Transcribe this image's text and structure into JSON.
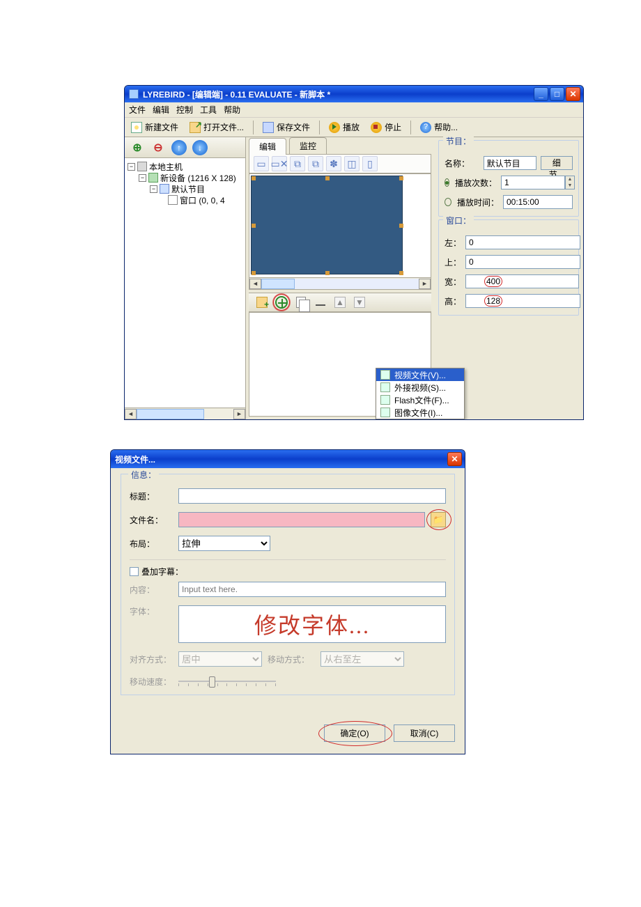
{
  "main": {
    "title": "LYREBIRD - [编辑端] - 0.11 EVALUATE - 新脚本 *",
    "menu": {
      "file": "文件",
      "edit": "编辑",
      "control": "控制",
      "tool": "工具",
      "help": "帮助"
    },
    "toolbar": {
      "new": "新建文件",
      "open": "打开文件...",
      "save": "保存文件",
      "play": "播放",
      "stop": "停止",
      "help": "帮助..."
    },
    "tree": {
      "root": "本地主机",
      "device": "新设备 (1216 X 128)",
      "program": "默认节目",
      "window": "窗口 (0, 0, 4"
    },
    "tabs": {
      "edit": "编辑",
      "monitor": "监控"
    },
    "program_group": {
      "legend": "节目：",
      "name_label": "名称：",
      "name_value": "默认节目",
      "detail_btn": "细节...",
      "count_label": "播放次数：",
      "count_value": "1",
      "time_label": "播放时间：",
      "time_value": "00:15:00"
    },
    "window_group": {
      "legend": "窗口：",
      "left_label": "左：",
      "left_value": "0",
      "top_label": "上：",
      "top_value": "0",
      "width_label": "宽：",
      "width_value": "400",
      "height_label": "高：",
      "height_value": "128"
    },
    "content_menu": {
      "video": "视频文件(V)...",
      "ext_video": "外接视频(S)...",
      "flash": "Flash文件(F)...",
      "image": "图像文件(I)..."
    }
  },
  "dialog": {
    "title": "视频文件...",
    "info_legend": "信息：",
    "title_label": "标题：",
    "title_value": "",
    "file_label": "文件名：",
    "file_value": "",
    "layout_label": "布局：",
    "layout_value": "拉伸",
    "overlay_label": "叠加字幕：",
    "content_label": "内容：",
    "content_placeholder": "Input text here.",
    "font_label": "字体：",
    "font_preview": "修改字体...",
    "align_label": "对齐方式：",
    "align_value": "居中",
    "move_label": "移动方式：",
    "move_value": "从右至左",
    "speed_label": "移动速度：",
    "ok": "确定(O)",
    "cancel": "取消(C)"
  }
}
